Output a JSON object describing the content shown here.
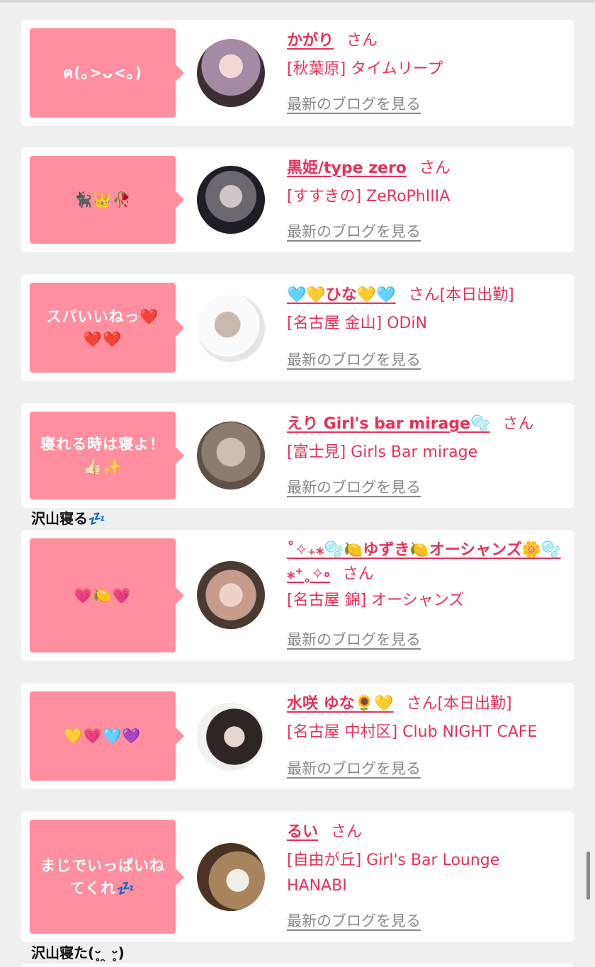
{
  "entries": [
    {
      "bubble": "ฅ(｡>ᴗ<｡)",
      "name": "かがり",
      "san": "さん",
      "shop": "[秋葉原] タイムリープ",
      "blog": "最新のブログを見る",
      "avatar_colors": [
        "#3a2d33",
        "#a48aa3",
        "#f2d7d5"
      ]
    },
    {
      "bubble": "🐈‍⬛👑🥀",
      "name": "黒姫/type zero",
      "san": "さん",
      "shop": "[すすきの] ZeRoPhIIIA",
      "blog": "最新のブログを見る",
      "avatar_colors": [
        "#1e1e24",
        "#6c6870",
        "#cfc6c8"
      ]
    },
    {
      "bubble": "スパいいねっ❤️❤️❤️",
      "name": "🩵💛ひな💛🩵",
      "san": "さん[本日出勤]",
      "shop": "[名古屋 金山] ODiN",
      "blog": "最新のブログを見る",
      "avatar_colors": [
        "#e7e4ea",
        "#c9b8ad",
        "#fbfafc"
      ]
    },
    {
      "bubble": "寝れる時は寝よ！👍🏻✨",
      "name": "えり Girl's bar mirage🫧",
      "san": "さん",
      "shop": "[富士見] Girls Bar mirage",
      "blog": "最新のブログを見る",
      "avatar_colors": [
        "#8a7c6e",
        "#cbbfb0",
        "#5e5148"
      ],
      "extra": "沢山寝る💤"
    },
    {
      "bubble": "💗🍋💗",
      "name": "˚✧₊⁎🫧🍋ゆずき🍋オーシャンズ🌼🫧⁎⁺˳✧༚",
      "san": "さん",
      "shop": "[名古屋 錦] オーシャンズ",
      "blog": "最新のブログを見る",
      "avatar_colors": [
        "#4a3a34",
        "#c59b8a",
        "#f1d2c8"
      ]
    },
    {
      "bubble": "💛💗🩵💜",
      "name": "水咲 ゆな🌻💛",
      "san": "さん[本日出勤]",
      "shop": "[名古屋 中村区] Club NIGHT CAFE",
      "blog": "最新のブログを見る",
      "avatar_colors": [
        "#f3f1f0",
        "#2e2625",
        "#e6d7d3"
      ]
    },
    {
      "bubble": "まじでいっぱいねてくれ💤",
      "name": "るい",
      "san": "さん",
      "shop": "[自由が丘] Girl's Bar Lounge HANABI",
      "blog": "最新のブログを見る",
      "avatar_colors": [
        "#4b3323",
        "#a7845e",
        "#f3efe6"
      ],
      "extra": "沢山寝た(ᵕ̥ ̯ ᵕ̥)"
    }
  ]
}
